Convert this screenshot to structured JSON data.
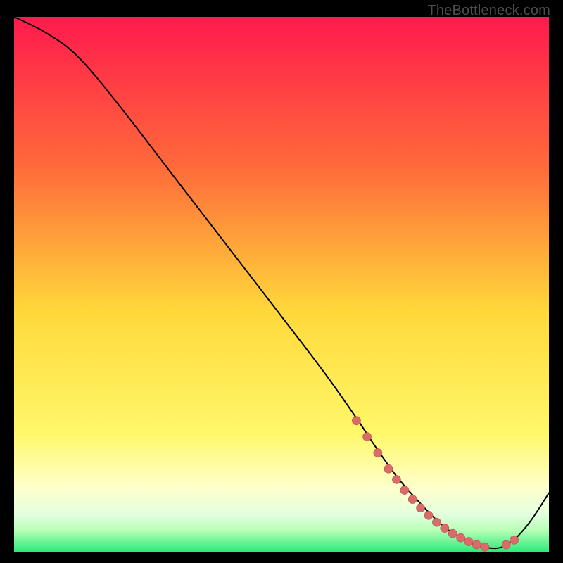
{
  "watermark": "TheBottleneck.com",
  "colors": {
    "bg": "#000000",
    "grad_top": "#ff1a4d",
    "grad_mid_upper": "#ff8a3a",
    "grad_mid": "#ffd83a",
    "grad_lower": "#fff86a",
    "grad_band_pale": "#ffffcc",
    "grad_band_green_light": "#b6ffb6",
    "grad_band_green": "#2bea7a",
    "curve": "#000000",
    "marker_fill": "#d96b6b",
    "marker_stroke": "#b94a4a"
  },
  "chart_data": {
    "type": "line",
    "title": "",
    "xlabel": "",
    "ylabel": "",
    "xlim": [
      0,
      100
    ],
    "ylim": [
      0,
      100
    ],
    "legend": null,
    "grid": false,
    "series": [
      {
        "name": "bottleneck-curve",
        "x": [
          0,
          6,
          12,
          20,
          30,
          40,
          50,
          58,
          64,
          68,
          72,
          76,
          80,
          84,
          88,
          92,
          96,
          100
        ],
        "y": [
          100,
          97,
          92.5,
          83,
          70,
          57,
          44,
          33.5,
          25,
          19,
          13.5,
          9,
          5,
          2.3,
          0.8,
          1.2,
          5,
          11
        ]
      }
    ],
    "markers": {
      "name": "highlighted-points",
      "x": [
        64,
        66,
        68,
        70,
        71.5,
        73,
        74.5,
        76,
        77.5,
        79,
        80.5,
        82,
        83.5,
        85,
        86.5,
        88,
        92,
        93.5
      ],
      "y": [
        24.5,
        21.5,
        18.5,
        15.5,
        13.5,
        11.5,
        9.8,
        8.2,
        6.8,
        5.5,
        4.4,
        3.4,
        2.6,
        1.9,
        1.3,
        0.9,
        1.3,
        2.2
      ]
    }
  }
}
